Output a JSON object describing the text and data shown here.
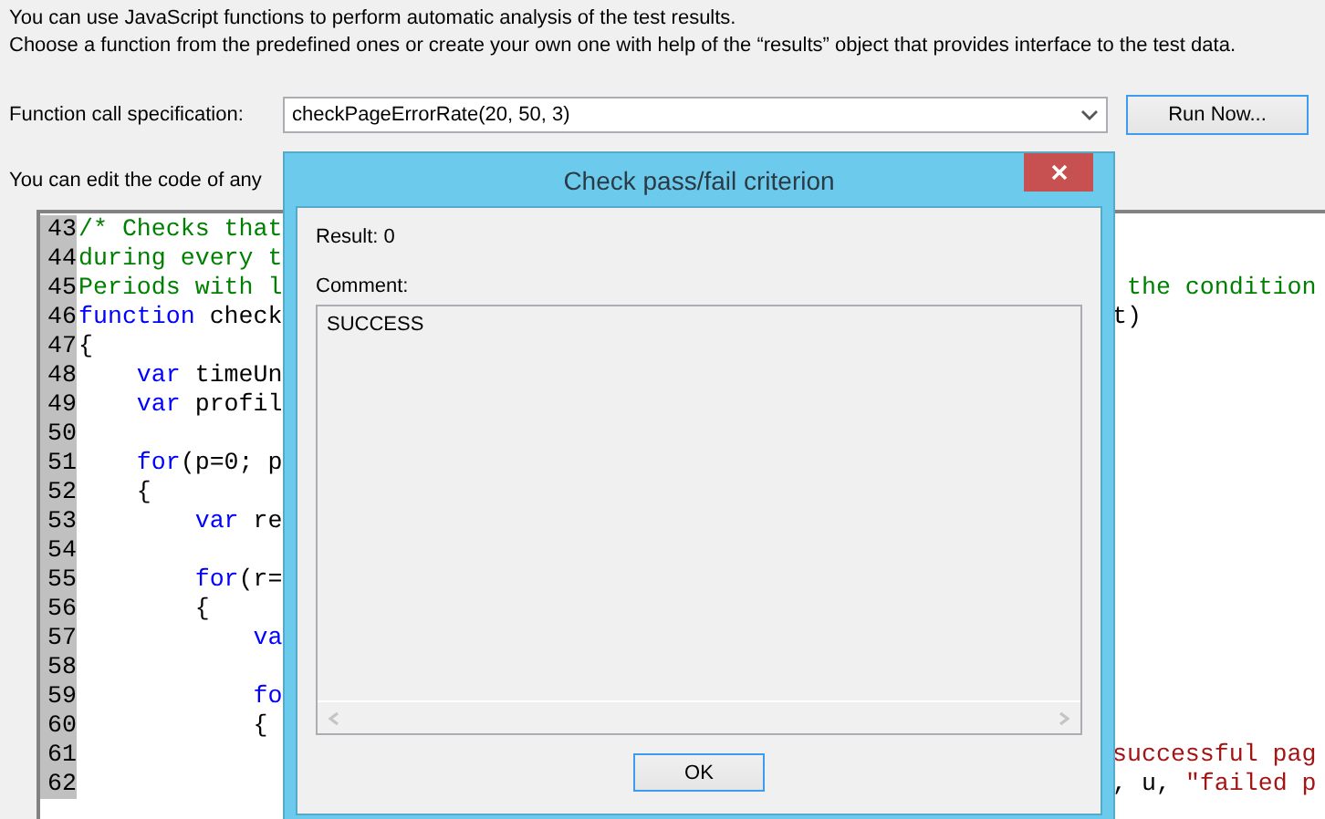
{
  "intro": [
    "You can use JavaScript functions to perform automatic analysis of the test results.",
    "Choose a function from the predefined ones or create your own one with help of the “results” object that provides interface to the test data."
  ],
  "function_call": {
    "label": "Function call specification:",
    "value": "checkPageErrorRate(20, 50, 3)",
    "button": "Run Now..."
  },
  "edit_hint": "You can edit the code of any",
  "code_lines": [
    {
      "number": "43",
      "left": [
        {
          "kind": "comment",
          "text": "/* Checks that"
        }
      ]
    },
    {
      "number": "44",
      "left": [
        {
          "kind": "comment",
          "text": "during every t"
        }
      ]
    },
    {
      "number": "45",
      "left": [
        {
          "kind": "comment",
          "text": "Periods with l"
        }
      ],
      "right": [
        {
          "kind": "comment",
          "text": " the condition"
        }
      ]
    },
    {
      "number": "46",
      "left": [
        {
          "kind": "keyword",
          "text": "function"
        },
        {
          "kind": "plain",
          "text": " check"
        }
      ],
      "right": [
        {
          "kind": "plain",
          "text": "t)"
        }
      ]
    },
    {
      "number": "47",
      "left": [
        {
          "kind": "plain",
          "text": "{"
        }
      ]
    },
    {
      "number": "48",
      "left": [
        {
          "kind": "keyword",
          "text": "    var"
        },
        {
          "kind": "plain",
          "text": " timeUn"
        }
      ]
    },
    {
      "number": "49",
      "left": [
        {
          "kind": "keyword",
          "text": "    var"
        },
        {
          "kind": "plain",
          "text": " profil"
        }
      ]
    },
    {
      "number": "50"
    },
    {
      "number": "51",
      "left": [
        {
          "kind": "keyword",
          "text": "    for"
        },
        {
          "kind": "plain",
          "text": "(p=0; p"
        }
      ]
    },
    {
      "number": "52",
      "left": [
        {
          "kind": "plain",
          "text": "    {"
        }
      ]
    },
    {
      "number": "53",
      "left": [
        {
          "kind": "keyword",
          "text": "        var"
        },
        {
          "kind": "plain",
          "text": " re"
        }
      ]
    },
    {
      "number": "54"
    },
    {
      "number": "55",
      "left": [
        {
          "kind": "keyword",
          "text": "        for"
        },
        {
          "kind": "plain",
          "text": "(r="
        }
      ]
    },
    {
      "number": "56",
      "left": [
        {
          "kind": "plain",
          "text": "        {"
        }
      ]
    },
    {
      "number": "57",
      "left": [
        {
          "kind": "keyword",
          "text": "            va"
        }
      ]
    },
    {
      "number": "58"
    },
    {
      "number": "59",
      "left": [
        {
          "kind": "keyword",
          "text": "            fo"
        }
      ]
    },
    {
      "number": "60",
      "left": [
        {
          "kind": "plain",
          "text": "            {"
        }
      ]
    },
    {
      "number": "61",
      "right": [
        {
          "kind": "string",
          "text": "successful pag"
        }
      ]
    },
    {
      "number": "62",
      "right": [
        {
          "kind": "plain",
          "text": ", u, "
        },
        {
          "kind": "string",
          "text": "\"failed p"
        }
      ]
    }
  ],
  "dialog": {
    "title": "Check pass/fail criterion",
    "result": "Result: 0",
    "comment_label": "Comment:",
    "comment": "SUCCESS",
    "button": "OK"
  }
}
